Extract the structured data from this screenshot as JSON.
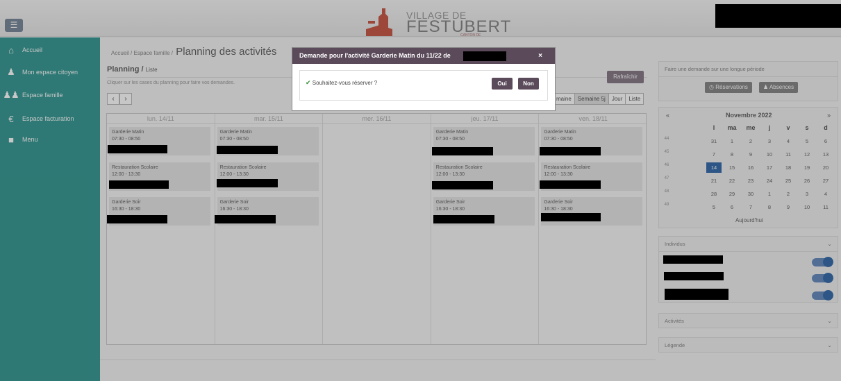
{
  "header": {
    "logo_line1": "VILLAGE DE",
    "logo_line2": "FESTUBERT",
    "logo_line3": "CANTON DE DOUVRIN"
  },
  "sidebar": {
    "items": [
      {
        "label": "Accueil",
        "icon": "home-icon"
      },
      {
        "label": "Mon espace citoyen",
        "icon": "user-icon"
      },
      {
        "label": "Espace famille",
        "icon": "family-icon"
      },
      {
        "label": "Espace facturation",
        "icon": "euro-icon"
      },
      {
        "label": "Menu",
        "icon": "menu-square-icon"
      }
    ]
  },
  "breadcrumb": {
    "item1": "Accueil",
    "sep": "/",
    "item2": "Espace famille",
    "title": "Planning des activités"
  },
  "planning": {
    "title": "Planning /",
    "subtitle": "Liste",
    "hint": "Cliquer sur les cases du planning pour faire vos demandes.",
    "prev": "‹",
    "next": "›",
    "refresh": "Rafraîchir",
    "views": [
      "maine",
      "Semaine 5j",
      "Jour",
      "Liste"
    ],
    "days": [
      {
        "label": "lun. 14/11",
        "activities": [
          {
            "name": "Garderie Matin",
            "time": "07:30 - 08:50"
          },
          {
            "name": "Restauration Scolaire",
            "time": "12:00 - 13:30"
          },
          {
            "name": "Garderie Soir",
            "time": "16:30 - 18:30"
          }
        ]
      },
      {
        "label": "mar. 15/11",
        "activities": [
          {
            "name": "Garderie Matin",
            "time": "07:30 - 08:50"
          },
          {
            "name": "Restauration Scolaire",
            "time": "12:00 - 13:30"
          },
          {
            "name": "Garderie Soir",
            "time": "16:30 - 18:30"
          }
        ]
      },
      {
        "label": "mer. 16/11",
        "activities": []
      },
      {
        "label": "jeu. 17/11",
        "activities": [
          {
            "name": "Garderie Matin",
            "time": "07:30 - 08:50"
          },
          {
            "name": "Restauration Scolaire",
            "time": "12:00 - 13:30"
          },
          {
            "name": "Garderie Soir",
            "time": "16:30 - 18:30"
          }
        ]
      },
      {
        "label": "ven. 18/11",
        "activities": [
          {
            "name": "Garderie Matin",
            "time": "07:30 - 08:50"
          },
          {
            "name": "Restauration Scolaire",
            "time": "12:00 - 13:30"
          },
          {
            "name": "Garderie Soir",
            "time": "16:30 - 18:30"
          }
        ]
      }
    ]
  },
  "right": {
    "long_period_title": "Faire une demande sur une longue période",
    "reservations": "Réservations",
    "absences": "Absences",
    "calendar": {
      "prev": "«",
      "next": "»",
      "month": "Novembre 2022",
      "dow": [
        "l",
        "ma",
        "me",
        "j",
        "v",
        "s",
        "d"
      ],
      "weeks": [
        {
          "wk": "44",
          "days": [
            "31",
            "1",
            "2",
            "3",
            "4",
            "5",
            "6"
          ]
        },
        {
          "wk": "45",
          "days": [
            "7",
            "8",
            "9",
            "10",
            "11",
            "12",
            "13"
          ]
        },
        {
          "wk": "46",
          "days": [
            "14",
            "15",
            "16",
            "17",
            "18",
            "19",
            "20"
          ]
        },
        {
          "wk": "47",
          "days": [
            "21",
            "22",
            "23",
            "24",
            "25",
            "26",
            "27"
          ]
        },
        {
          "wk": "48",
          "days": [
            "28",
            "29",
            "30",
            "1",
            "2",
            "3",
            "4"
          ]
        },
        {
          "wk": "49",
          "days": [
            "5",
            "6",
            "7",
            "8",
            "9",
            "10",
            "11"
          ]
        }
      ],
      "today_label": "Aujourd'hui",
      "today": "14"
    },
    "individus": "Individus",
    "activites": "Activités",
    "legende": "Légende"
  },
  "modal": {
    "title": "Demande pour l'activité Garderie Matin du 11/22 de",
    "close": "×",
    "question": "Souhaitez-vous réserver ?",
    "yes": "Oui",
    "no": "Non"
  },
  "colors": {
    "sidebar": "#3c9b96",
    "accent": "#5a4a5a",
    "today": "#3a6fae"
  }
}
